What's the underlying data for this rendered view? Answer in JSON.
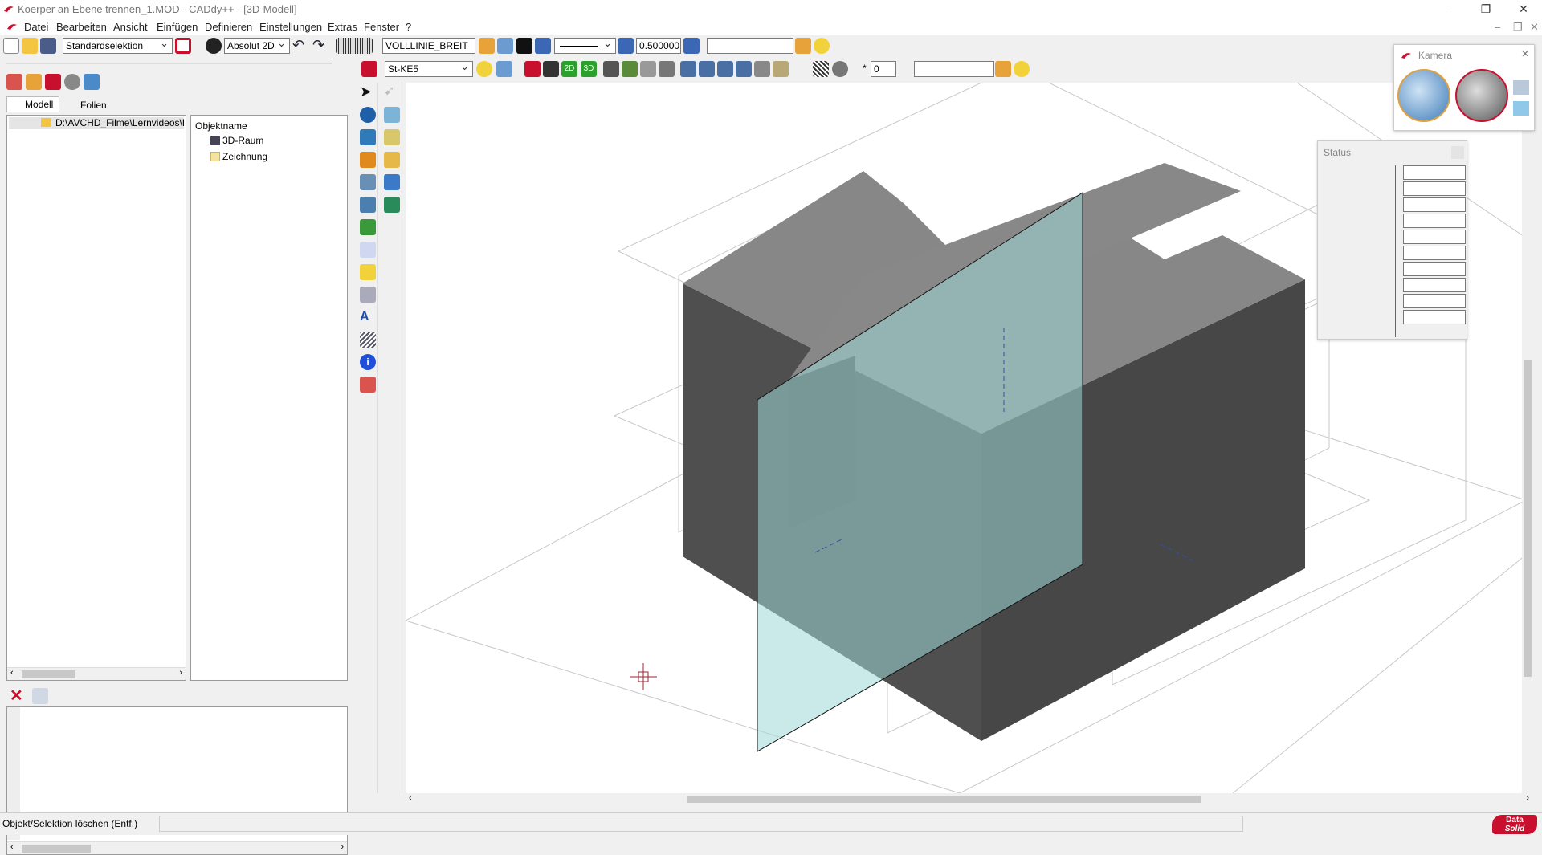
{
  "window": {
    "title": "Koerper an Ebene trennen_1.MOD  -  CADdy++ - [3D-Modell]",
    "minimize_icon": "minimize-icon",
    "restore_icon": "restore-icon",
    "close_icon": "close-icon"
  },
  "menu": [
    "Datei",
    "Bearbeiten",
    "Ansicht",
    "Einfügen",
    "Definieren",
    "Einstellungen",
    "Extras",
    "Fenster",
    "?"
  ],
  "toolbar1": {
    "selection_mode": "Standardselektion",
    "coord_mode": "Absolut 2D",
    "line_type": "VOLLLINIE_BREIT",
    "line_width": "0.500000",
    "empty_field": ""
  },
  "toolbar2": {
    "material": "St-KE5",
    "count": "0",
    "empty_field": ""
  },
  "left_panel": {
    "tabs": [
      "Modell",
      "Folien"
    ],
    "tree_path": "D:\\AVCHD_Filme\\Lernvideos\\E",
    "object_header": "Objektname",
    "objects": [
      "3D-Raum",
      "Zeichnung"
    ]
  },
  "camera_panel": {
    "title": "Kamera"
  },
  "status_panel": {
    "title": "Status"
  },
  "statusbar": {
    "message": "Objekt/Selektion löschen (Entf.)"
  },
  "brand": {
    "logo_line1": "Data",
    "logo_line2": "Solid"
  },
  "colors": {
    "accent_red": "#c8102e",
    "solid_top": "#878787",
    "solid_side_dark": "#4f4f4f",
    "plane_fill": "#9fd8d8"
  }
}
